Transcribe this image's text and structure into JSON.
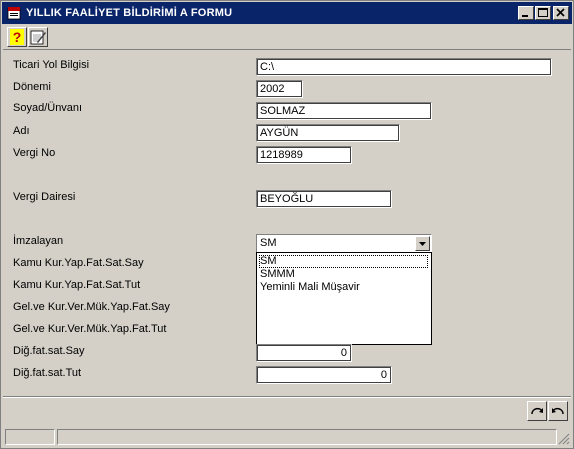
{
  "window": {
    "title": "YILLIK FAALİYET BİLDİRİMİ A FORMU"
  },
  "titlebar_icons": [
    "app-icon",
    "minimize-icon",
    "maximize-icon",
    "close-icon"
  ],
  "toolbar": {
    "buttons": [
      {
        "icon": "help-icon"
      },
      {
        "icon": "edit-icon"
      }
    ]
  },
  "form": {
    "ticari_yol": {
      "label": "Ticari Yol Bilgisi",
      "value": "C:\\"
    },
    "donemi": {
      "label": "Dönemi",
      "value": "2002"
    },
    "soyad": {
      "label": "Soyad/Ünvanı",
      "value": "SOLMAZ"
    },
    "adi": {
      "label": "Adı",
      "value": "AYGÜN"
    },
    "vergi_no": {
      "label": "Vergi No",
      "value": "1218989"
    },
    "vergi_dairesi": {
      "label": "Vergi Dairesi",
      "value": "BEYOĞLU"
    },
    "imzalayan": {
      "label": "İmzalayan",
      "value": "SM",
      "options": [
        "SM",
        "SMMM",
        "Yeminli Mali Müşavir"
      ],
      "selected_index": 0
    },
    "kamu_say": {
      "label": "Kamu Kur.Yap.Fat.Sat.Say"
    },
    "kamu_tut": {
      "label": "Kamu Kur.Yap.Fat.Sat.Tut"
    },
    "gel_say": {
      "label": "Gel.ve Kur.Ver.Mük.Yap.Fat.Say"
    },
    "gel_tut": {
      "label": "Gel.ve Kur.Ver.Mük.Yap.Fat.Tut"
    },
    "dig_say": {
      "label": "Diğ.fat.sat.Say",
      "value": "0"
    },
    "dig_tut": {
      "label": "Diğ.fat.sat.Tut",
      "value": "0"
    }
  },
  "bottom_buttons": [
    {
      "icon": "redo-icon"
    },
    {
      "icon": "undo-icon"
    }
  ],
  "colors": {
    "titlebar": "#0a246a",
    "face": "#d4d0c8"
  }
}
